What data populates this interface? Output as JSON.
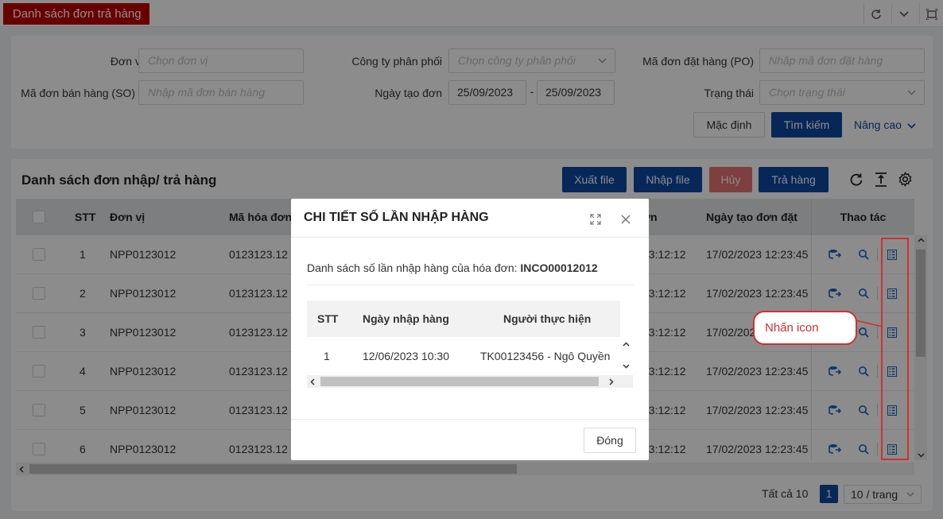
{
  "tab": {
    "title": "Danh sách đơn trả hàng"
  },
  "filters": {
    "don_vi": {
      "label": "Đơn vị",
      "placeholder": "Chọn đơn vị"
    },
    "cong_ty": {
      "label": "Công ty phân phối",
      "placeholder": "Chọn công ty phân phối"
    },
    "ma_po": {
      "label": "Mã đơn đặt hàng (PO)",
      "placeholder": "Nhập mã đơn đặt hàng"
    },
    "ma_so": {
      "label": "Mã đơn bán hàng (SO)",
      "placeholder": "Nhập mã đơn bán hàng"
    },
    "ngay_tao": {
      "label": "Ngày tạo đơn",
      "from": "25/09/2023",
      "to": "25/09/2023",
      "sep": "-"
    },
    "trang_thai": {
      "label": "Trạng thái",
      "placeholder": "Chọn trạng thái"
    },
    "buttons": {
      "default": "Mặc định",
      "search": "Tìm kiếm",
      "advanced": "Nâng cao"
    }
  },
  "list": {
    "title": "Danh sách đơn nhập/ trả hàng",
    "buttons": {
      "export": "Xuất file",
      "import": "Nhập file",
      "cancel": "Hủy",
      "return": "Trả hàng"
    },
    "columns": {
      "stt": "STT",
      "don_vi": "Đơn vị",
      "ma_hoa_don": "Mã hóa đơn",
      "col4": "ơn",
      "ngay_tao": "Ngày tạo đơn đặt",
      "actions": "Thao tác"
    },
    "rows": [
      {
        "stt": "1",
        "don_vi": "NPP0123012",
        "ma": "0123123.12",
        "t1": "23:12:12",
        "ngay": "17/02/2023 12:23:45"
      },
      {
        "stt": "2",
        "don_vi": "NPP0123012",
        "ma": "0123123.12",
        "t1": "23:12:12",
        "ngay": "17/02/2023 12:23:45"
      },
      {
        "stt": "3",
        "don_vi": "NPP0123012",
        "ma": "0123123.12",
        "t1": "23:12:12",
        "ngay": "17/02/2023 12:23:45"
      },
      {
        "stt": "4",
        "don_vi": "NPP0123012",
        "ma": "0123123.12",
        "t1": "23:12:12",
        "ngay": "17/02/2023 12:23:45"
      },
      {
        "stt": "5",
        "don_vi": "NPP0123012",
        "ma": "0123123.12",
        "t1": "23:12:12",
        "ngay": "17/02/2023 12:23:45"
      },
      {
        "stt": "6",
        "don_vi": "NPP0123012",
        "ma": "0123123.12",
        "t1": "23:12:12",
        "ngay": "17/02/2023 12:23:45"
      }
    ]
  },
  "pagination": {
    "total": "Tất cả 10",
    "page": "1",
    "page_size": "10 / trang"
  },
  "annotation": {
    "text": "Nhấn icon",
    "color": "#d32f2f"
  },
  "modal": {
    "title": "CHI TIẾT SỐ LẦN NHẬP HÀNG",
    "desc_prefix": "Danh sách số lần nhập hàng của hóa đơn: ",
    "invoice": "INCO00012012",
    "columns": {
      "stt": "STT",
      "ngay": "Ngày nhập hàng",
      "nguoi": "Người thực hiện"
    },
    "rows": [
      {
        "stt": "1",
        "ngay": "12/06/2023 10:30",
        "nguoi": "TK00123456 - Ngô Quyền"
      }
    ],
    "close": "Đóng"
  },
  "colors": {
    "brand_red": "#c00000",
    "primary": "#0d47a1",
    "danger": "#e57373",
    "icon_blue": "#1565c0"
  }
}
